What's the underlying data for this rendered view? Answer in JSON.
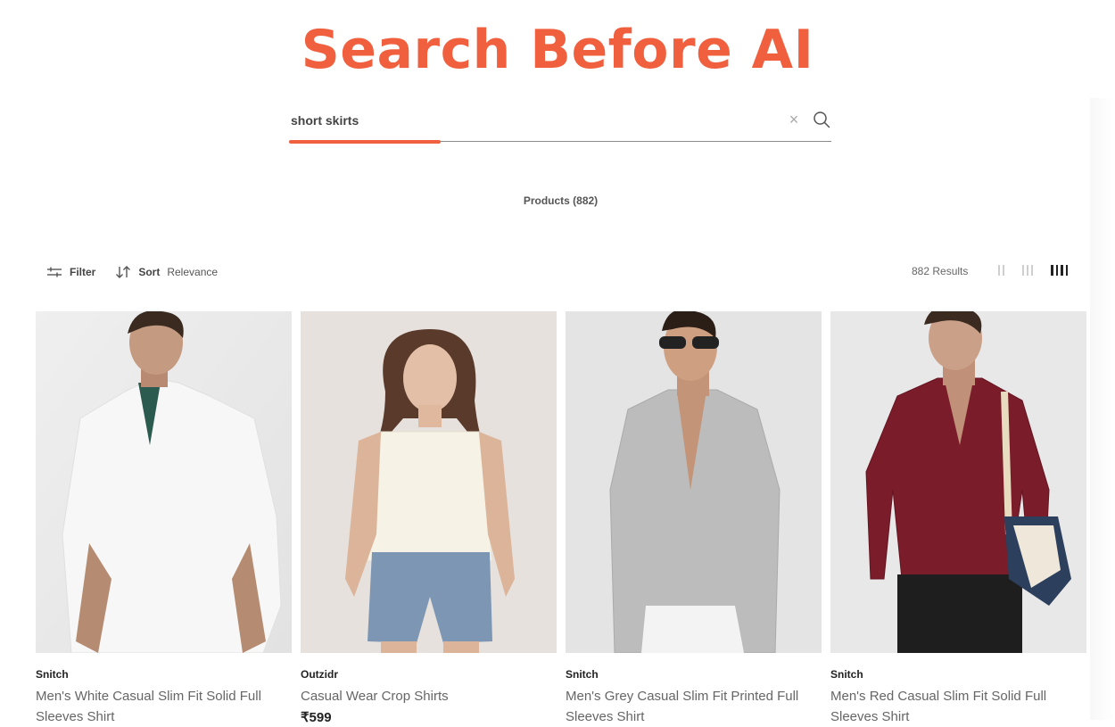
{
  "headline": "Search Before AI",
  "search": {
    "value": "short skirts",
    "loading_progress": 0.28
  },
  "products_count": "Products (882)",
  "toolbar": {
    "filter_label": "Filter",
    "sort_label": "Sort",
    "sort_value": "Relevance",
    "results": "882 Results"
  },
  "products": [
    {
      "brand": "Snitch",
      "name": "Men's White Casual Slim Fit Solid Full Sleeves Shirt",
      "price": ""
    },
    {
      "brand": "Outzidr",
      "name": "Casual Wear Crop Shirts",
      "price": "₹599"
    },
    {
      "brand": "Snitch",
      "name": "Men's Grey Casual Slim Fit Printed Full Sleeves Shirt",
      "price": ""
    },
    {
      "brand": "Snitch",
      "name": "Men's Red Casual Slim Fit Solid Full Sleeves Shirt",
      "price": ""
    }
  ],
  "colors": {
    "accent": "#f0603f"
  },
  "icons": [
    "clear-icon",
    "search-icon",
    "filter-icon",
    "sort-icon",
    "grid-2-icon",
    "grid-3-icon",
    "grid-4-icon"
  ]
}
